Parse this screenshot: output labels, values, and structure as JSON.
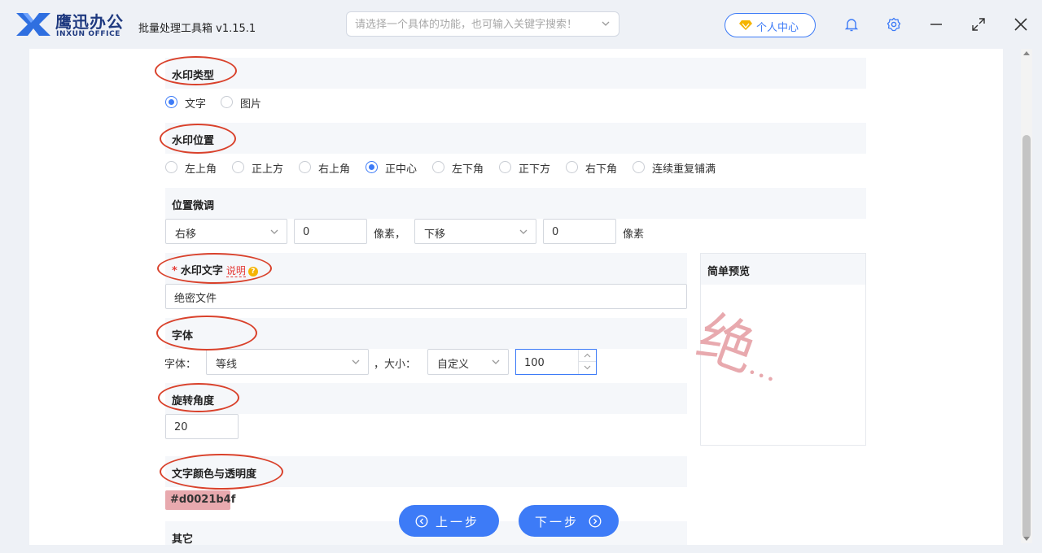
{
  "header": {
    "brand_name": "鹰迅办公",
    "brand_sub": "INXUN OFFICE",
    "app_title": "批量处理工具箱 v1.15.1",
    "search_placeholder": "请选择一个具体的功能，也可输入关键字搜索！",
    "user_center_label": "个人中心"
  },
  "watermark_type": {
    "title": "水印类型",
    "options": [
      "文字",
      "图片"
    ],
    "selected": "文字"
  },
  "watermark_position": {
    "title": "水印位置",
    "options": [
      "左上角",
      "正上方",
      "右上角",
      "正中心",
      "左下角",
      "正下方",
      "右下角",
      "连续重复铺满"
    ],
    "selected": "正中心"
  },
  "position_adjust": {
    "title": "位置微调",
    "horizontal_direction": "右移",
    "horizontal_value": "0",
    "unit_1": "像素，",
    "vertical_direction": "下移",
    "vertical_value": "0",
    "unit_2": "像素"
  },
  "watermark_text": {
    "required_mark": "*",
    "title": "水印文字",
    "explain_label": "说明",
    "help_mark": "?",
    "value": "绝密文件"
  },
  "font": {
    "title": "字体",
    "family_label": "字体：",
    "family_value": "等线",
    "size_label": "，大小：",
    "size_mode": "自定义",
    "size_value": "100"
  },
  "rotation": {
    "title": "旋转角度",
    "value": "20"
  },
  "color": {
    "title": "文字颜色与透明度",
    "value": "#d0021b4f"
  },
  "other": {
    "title": "其它"
  },
  "preview": {
    "title": "简单预览",
    "text": "绝",
    "ellipsis": "…"
  },
  "footer": {
    "prev_label": "上一步",
    "next_label": "下一步"
  },
  "colors": {
    "accent": "#3d7bf7",
    "annotation": "#d9412b",
    "watermark": "#e8a9ae"
  }
}
